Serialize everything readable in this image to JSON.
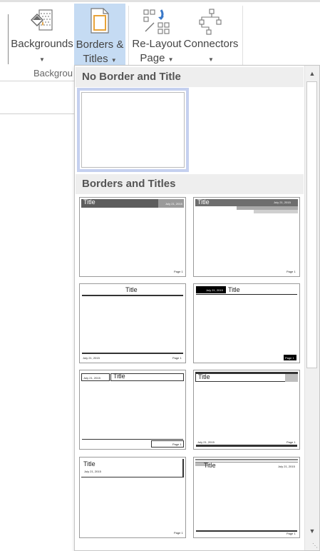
{
  "ribbon": {
    "buttons": [
      {
        "label_line1": "Backgrounds",
        "icon": "paint-bucket-page-icon"
      },
      {
        "label_line1": "Borders &",
        "label_line2": "Titles",
        "icon": "page-border-icon"
      },
      {
        "label_line1": "Re-Layout",
        "label_line2": "Page",
        "icon": "relayout-icon"
      },
      {
        "label_line1": "Connectors",
        "icon": "connectors-icon"
      }
    ],
    "group_label": "Backgrou"
  },
  "gallery": {
    "sections": [
      {
        "title": "No Border and Title"
      },
      {
        "title": "Borders and Titles"
      }
    ],
    "thumb_text": {
      "title": "Title",
      "date": "July 21, 2015",
      "page": "Page 1"
    }
  },
  "colors": {
    "selected_button_bg": "#c5dbf3",
    "selected_thumb_border": "#c5d0ef",
    "section_header_bg": "#eeeeee"
  }
}
